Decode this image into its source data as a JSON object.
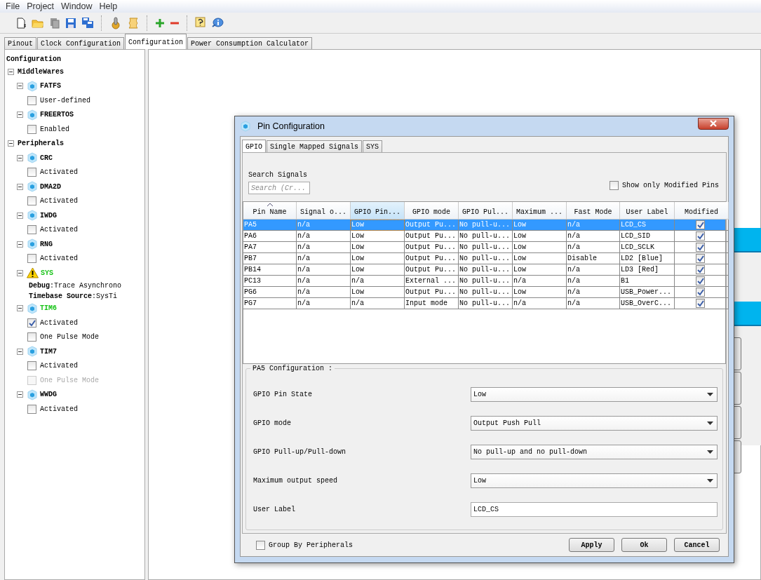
{
  "menu": [
    "File",
    "Project",
    "Window",
    "Help"
  ],
  "toolbar": [
    {
      "kind": "new"
    },
    {
      "kind": "open"
    },
    {
      "kind": "copy"
    },
    {
      "kind": "save"
    },
    {
      "kind": "saveall"
    },
    {
      "kind": "sep"
    },
    {
      "kind": "generate"
    },
    {
      "kind": "script"
    },
    {
      "kind": "sep"
    },
    {
      "kind": "plus"
    },
    {
      "kind": "minus"
    },
    {
      "kind": "sep"
    },
    {
      "kind": "help"
    },
    {
      "kind": "info"
    }
  ],
  "tabs": [
    {
      "label": "Pinout",
      "selected": false
    },
    {
      "label": "Clock Configuration",
      "selected": false
    },
    {
      "label": "Configuration",
      "selected": true
    },
    {
      "label": "Power Consumption Calculator",
      "selected": false
    }
  ],
  "tree": {
    "label": "Configuration",
    "children": [
      {
        "kind": "category",
        "label": "MiddleWares",
        "expanded": true,
        "children": [
          {
            "kind": "module",
            "label": "FATFS",
            "warning": false,
            "color": "#000000",
            "expanded": true,
            "children": [
              {
                "kind": "checkbox",
                "label": "User-defined",
                "checked": false,
                "disabled": false
              }
            ]
          },
          {
            "kind": "module",
            "label": "FREERTOS",
            "warning": false,
            "color": "#000000",
            "expanded": true,
            "children": [
              {
                "kind": "checkbox",
                "label": "Enabled",
                "checked": false,
                "disabled": false
              }
            ]
          }
        ]
      },
      {
        "kind": "category",
        "label": "Peripherals",
        "expanded": true,
        "children": [
          {
            "kind": "module",
            "label": "CRC",
            "warning": false,
            "color": "#000000",
            "expanded": true,
            "children": [
              {
                "kind": "checkbox",
                "label": "Activated",
                "checked": false,
                "disabled": false
              }
            ]
          },
          {
            "kind": "module",
            "label": "DMA2D",
            "warning": false,
            "color": "#000000",
            "expanded": true,
            "children": [
              {
                "kind": "checkbox",
                "label": "Activated",
                "checked": false,
                "disabled": false
              }
            ]
          },
          {
            "kind": "module",
            "label": "IWDG",
            "warning": false,
            "color": "#000000",
            "expanded": true,
            "children": [
              {
                "kind": "checkbox",
                "label": "Activated",
                "checked": false,
                "disabled": false
              }
            ]
          },
          {
            "kind": "module",
            "label": "RNG",
            "warning": false,
            "color": "#000000",
            "expanded": true,
            "children": [
              {
                "kind": "checkbox",
                "label": "Activated",
                "checked": false,
                "disabled": false
              }
            ]
          },
          {
            "kind": "module",
            "label": "SYS",
            "warning": true,
            "color": "#19c319",
            "expanded": true,
            "children": [
              {
                "kind": "info",
                "text": "**Debug**:Trace Asynchrono"
              },
              {
                "kind": "info",
                "text": "**Timebase Source**:SysTi"
              }
            ]
          },
          {
            "kind": "module",
            "label": "TIM6",
            "warning": false,
            "color": "#19c319",
            "expanded": true,
            "children": [
              {
                "kind": "checkbox",
                "label": "Activated",
                "checked": true,
                "disabled": false
              },
              {
                "kind": "checkbox",
                "label": "One Pulse Mode",
                "checked": false,
                "disabled": false
              }
            ]
          },
          {
            "kind": "module",
            "label": "TIM7",
            "warning": false,
            "color": "#000000",
            "expanded": true,
            "children": [
              {
                "kind": "checkbox",
                "label": "Activated",
                "checked": false,
                "disabled": false
              },
              {
                "kind": "checkbox",
                "label": "One Pulse Mode",
                "checked": false,
                "disabled": true
              }
            ]
          },
          {
            "kind": "module",
            "label": "WWDG",
            "warning": false,
            "color": "#000000",
            "expanded": true,
            "children": [
              {
                "kind": "checkbox",
                "label": "Activated",
                "checked": false,
                "disabled": false
              }
            ]
          }
        ]
      }
    ]
  },
  "dialog": {
    "title": "Pin Configuration",
    "tabs": [
      {
        "label": "GPIO",
        "selected": true
      },
      {
        "label": "Single Mapped Signals",
        "selected": false
      },
      {
        "label": "SYS",
        "selected": false
      }
    ],
    "search": {
      "label": "Search Signals",
      "placeholder": "Search (Cr..."
    },
    "modified_filter": {
      "label": "Show only Modified Pins",
      "checked": false
    },
    "table": {
      "columns": [
        {
          "label": "Pin Name",
          "sorted": true,
          "selected": false
        },
        {
          "label": "Signal o...",
          "sorted": false,
          "selected": false
        },
        {
          "label": "GPIO Pin...",
          "sorted": false,
          "selected": true
        },
        {
          "label": "GPIO mode",
          "sorted": false,
          "selected": false
        },
        {
          "label": "GPIO Pul...",
          "sorted": false,
          "selected": false
        },
        {
          "label": "Maximum ...",
          "sorted": false,
          "selected": false
        },
        {
          "label": "Fast Mode",
          "sorted": false,
          "selected": false
        },
        {
          "label": "User Label",
          "sorted": false,
          "selected": false
        },
        {
          "label": "Modified",
          "sorted": false,
          "selected": false
        }
      ],
      "rows": [
        {
          "cells": [
            "PA5",
            "n/a",
            "Low",
            "Output Pu...",
            "No pull-u...",
            "Low",
            "n/a",
            "LCD_CS"
          ],
          "modified": true,
          "selected": true
        },
        {
          "cells": [
            "PA6",
            "n/a",
            "Low",
            "Output Pu...",
            "No pull-u...",
            "Low",
            "n/a",
            "LCD_SID"
          ],
          "modified": true,
          "selected": false
        },
        {
          "cells": [
            "PA7",
            "n/a",
            "Low",
            "Output Pu...",
            "No pull-u...",
            "Low",
            "n/a",
            "LCD_SCLK"
          ],
          "modified": true,
          "selected": false
        },
        {
          "cells": [
            "PB7",
            "n/a",
            "Low",
            "Output Pu...",
            "No pull-u...",
            "Low",
            "Disable",
            "LD2 [Blue]"
          ],
          "modified": true,
          "selected": false
        },
        {
          "cells": [
            "PB14",
            "n/a",
            "Low",
            "Output Pu...",
            "No pull-u...",
            "Low",
            "n/a",
            "LD3 [Red]"
          ],
          "modified": true,
          "selected": false
        },
        {
          "cells": [
            "PC13",
            "n/a",
            "n/a",
            "External ...",
            "No pull-u...",
            "n/a",
            "n/a",
            "B1"
          ],
          "modified": true,
          "selected": false
        },
        {
          "cells": [
            "PG6",
            "n/a",
            "Low",
            "Output Pu...",
            "No pull-u...",
            "Low",
            "n/a",
            "USB_Power..."
          ],
          "modified": true,
          "selected": false
        },
        {
          "cells": [
            "PG7",
            "n/a",
            "n/a",
            "Input mode",
            "No pull-u...",
            "n/a",
            "n/a",
            "USB_OverC..."
          ],
          "modified": true,
          "selected": false
        }
      ]
    },
    "config": {
      "title": "PA5 Configuration :",
      "fields": [
        {
          "label": "GPIO Pin State",
          "kind": "select",
          "value": "Low"
        },
        {
          "label": "GPIO mode",
          "kind": "select",
          "value": "Output Push Pull"
        },
        {
          "label": "GPIO Pull-up/Pull-down",
          "kind": "select",
          "value": "No pull-up and no pull-down"
        },
        {
          "label": "Maximum output speed",
          "kind": "select",
          "value": "Low"
        },
        {
          "label": "User Label",
          "kind": "text",
          "value": "LCD_CS"
        }
      ]
    },
    "group_by": {
      "label": "Group By Peripherals",
      "checked": false
    },
    "buttons": [
      "Apply",
      "Ok",
      "Cancel"
    ]
  }
}
